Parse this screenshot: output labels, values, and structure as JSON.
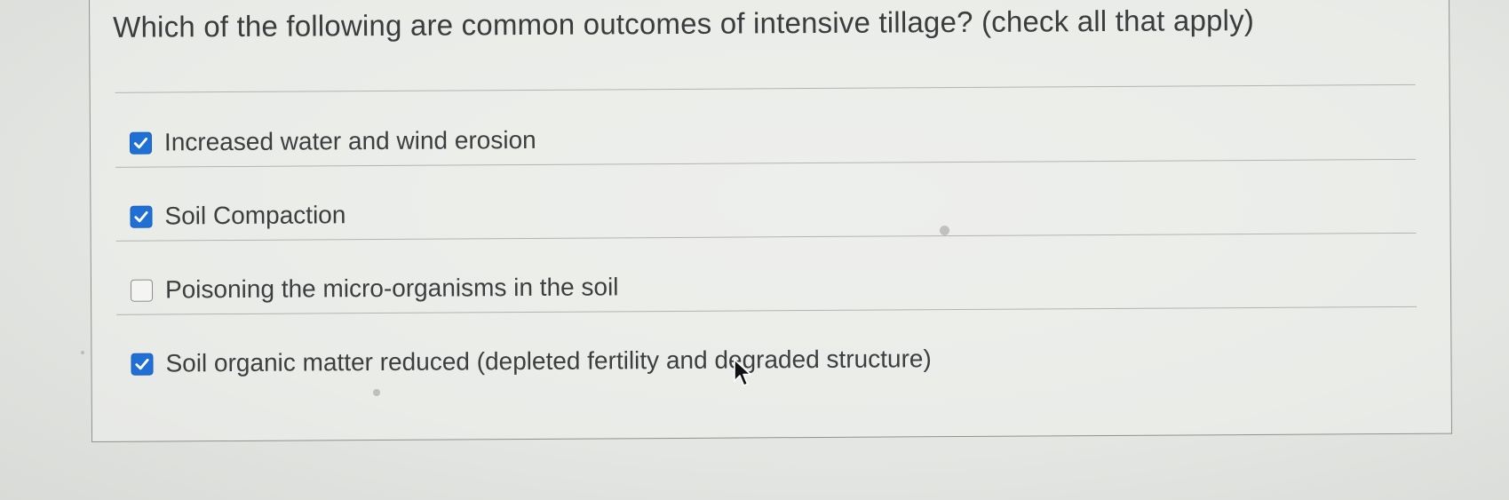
{
  "question": {
    "text": "Which of the following are common outcomes of intensive tillage? (check all that apply)"
  },
  "options": [
    {
      "label": "Increased water and wind erosion",
      "checked": true
    },
    {
      "label": "Soil Compaction",
      "checked": true
    },
    {
      "label": "Poisoning the micro-organisms in the soil",
      "checked": false
    },
    {
      "label": "Soil organic matter reduced (depleted fertility and degraded structure)",
      "checked": true
    }
  ],
  "colors": {
    "checkbox_checked": "#1f6fd4",
    "text": "#3a3c3e",
    "background": "#e6e8e5"
  },
  "icons": {
    "check": "checkmark-icon",
    "pointer": "mouse-pointer-icon"
  }
}
